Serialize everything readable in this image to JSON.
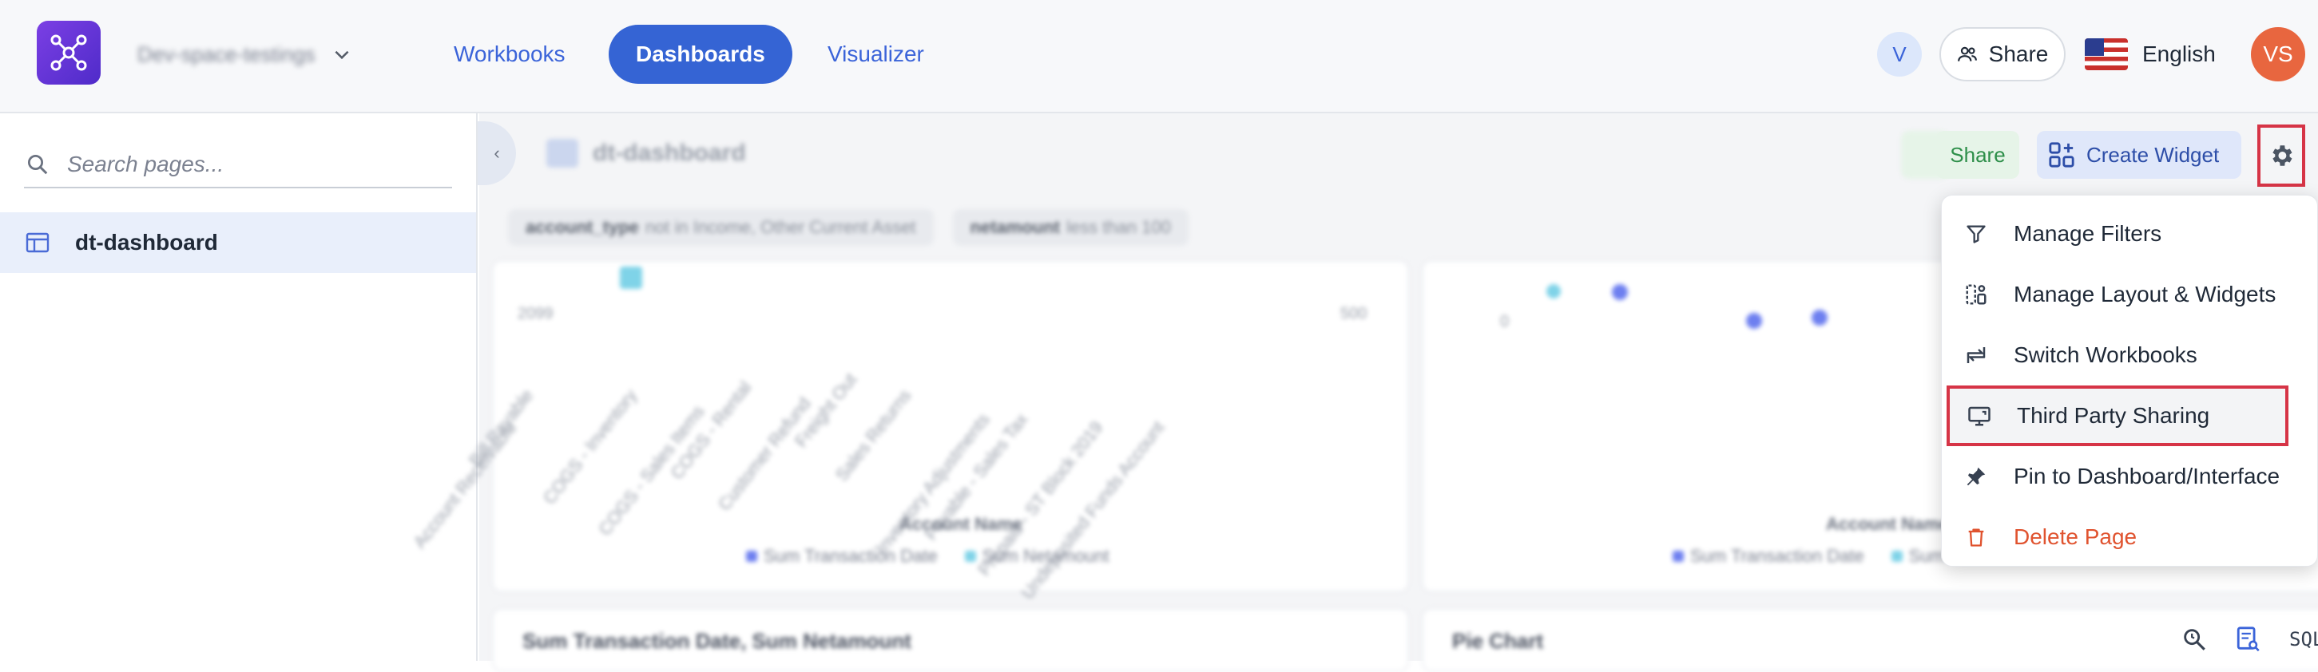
{
  "app": {
    "workspace_name": "Dev-space-testings",
    "nav_tabs": [
      {
        "label": "Workbooks",
        "active": false
      },
      {
        "label": "Dashboards",
        "active": true
      },
      {
        "label": "Visualizer",
        "active": false
      }
    ],
    "user_initial": "V",
    "share_label": "Share",
    "language": "English",
    "avatar_initials": "VS"
  },
  "sidebar": {
    "search_placeholder": "Search pages...",
    "pages": [
      {
        "label": "dt-dashboard",
        "icon": "table-icon",
        "selected": true
      }
    ]
  },
  "dashboard": {
    "title": "dt-dashboard",
    "share_label": "Share",
    "create_widget_label": "Create Widget",
    "filters": [
      {
        "field": "account_type",
        "condition": "not in Income, Other Current Asset"
      },
      {
        "field": "netamount",
        "condition": "less than 100"
      }
    ],
    "left_chart": {
      "xlabel": "Account Name",
      "legend": [
        "Sum Transaction Date",
        "Sum Netamount"
      ],
      "y_left_tick": "2099",
      "y_right_tick": "500",
      "x_labels": [
        "Account Receivable",
        "Bill Payable",
        "COGS - Inventory",
        "COGS - Sales Items",
        "COGS - Rental",
        "Customer Refund",
        "Freight Out",
        "Sales Returns",
        "Inventory Adjustments",
        "Payable - Sales Tax",
        "Prepaid - ST Block 2019",
        "Undeposited Funds Account"
      ]
    },
    "right_chart": {
      "xlabel": "Account Name",
      "legend": [
        "Sum Transaction Date",
        "Sum Netamount"
      ],
      "y_left_tick": "0"
    },
    "bottom_cards": [
      {
        "title": "Sum Transaction Date, Sum Netamount"
      },
      {
        "title": "Pie Chart"
      }
    ]
  },
  "settings_menu": {
    "items": [
      {
        "label": "Manage Filters",
        "icon": "filter-icon",
        "highlighted": false,
        "danger": false
      },
      {
        "label": "Manage Layout & Widgets",
        "icon": "layout-icon",
        "highlighted": false,
        "danger": false
      },
      {
        "label": "Switch Workbooks",
        "icon": "switch-icon",
        "highlighted": false,
        "danger": false
      },
      {
        "label": "Third Party Sharing",
        "icon": "screen-share-icon",
        "highlighted": true,
        "danger": false
      },
      {
        "label": "Pin to Dashboard/Interface",
        "icon": "pin-icon",
        "highlighted": false,
        "danger": false
      },
      {
        "label": "Delete Page",
        "icon": "trash-icon",
        "highlighted": false,
        "danger": true
      }
    ]
  },
  "bottom_toolbar": {
    "sql_label": "SQL"
  },
  "colors": {
    "brand_purple": "#5b2fd6",
    "primary_blue": "#3564d4",
    "danger_red": "#e0532f",
    "highlight_border": "#d63446"
  }
}
